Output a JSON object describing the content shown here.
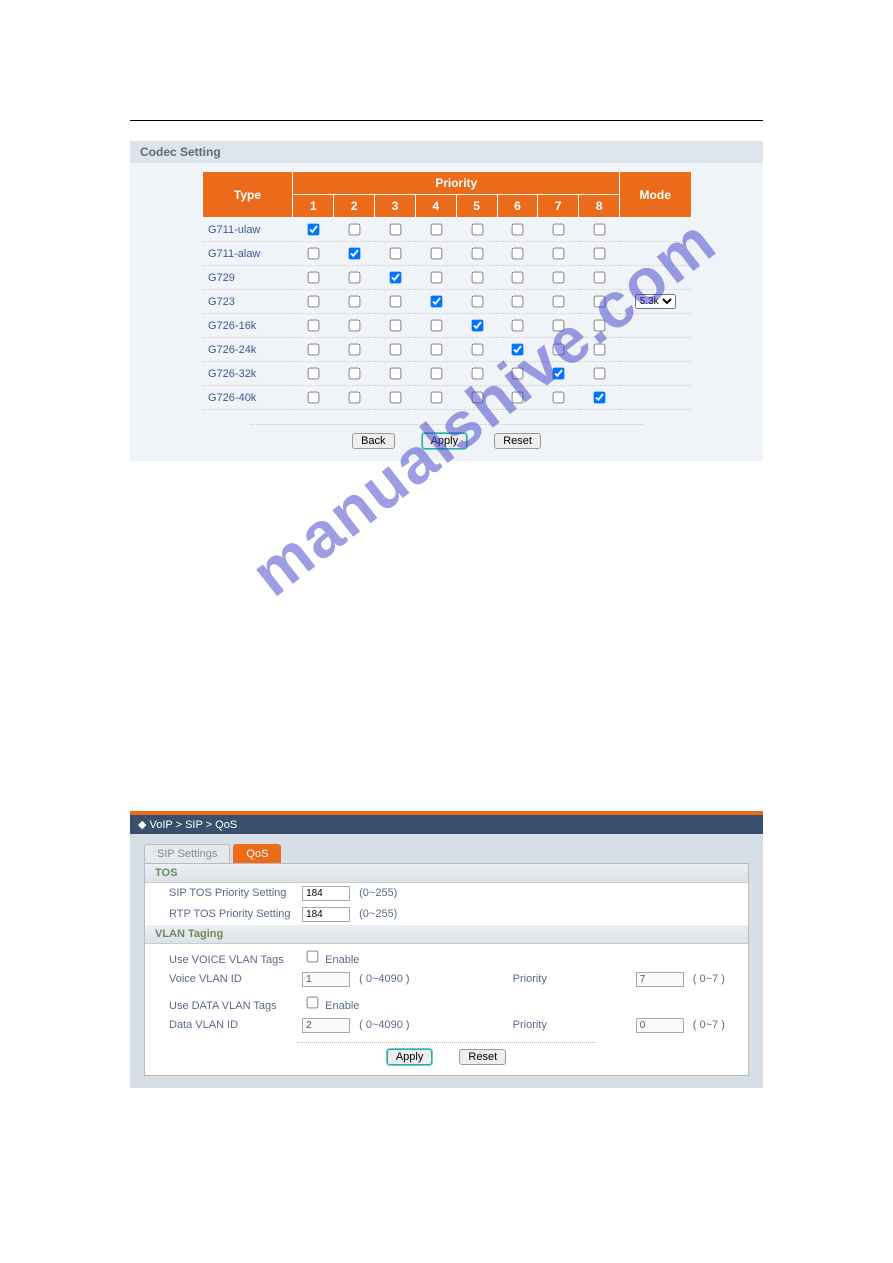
{
  "codec": {
    "panel_title": "Codec Setting",
    "header_type": "Type",
    "header_priority": "Priority",
    "header_mode": "Mode",
    "priorities": [
      "1",
      "2",
      "3",
      "4",
      "5",
      "6",
      "7",
      "8"
    ],
    "rows": [
      {
        "type": "G711-ulaw",
        "checked": [
          true,
          false,
          false,
          false,
          false,
          false,
          false,
          false
        ],
        "mode": null
      },
      {
        "type": "G711-alaw",
        "checked": [
          false,
          true,
          false,
          false,
          false,
          false,
          false,
          false
        ],
        "mode": null
      },
      {
        "type": "G729",
        "checked": [
          false,
          false,
          true,
          false,
          false,
          false,
          false,
          false
        ],
        "mode": null
      },
      {
        "type": "G723",
        "checked": [
          false,
          false,
          false,
          true,
          false,
          false,
          false,
          false
        ],
        "mode": "5.3k"
      },
      {
        "type": "G726-16k",
        "checked": [
          false,
          false,
          false,
          false,
          true,
          false,
          false,
          false
        ],
        "mode": null
      },
      {
        "type": "G726-24k",
        "checked": [
          false,
          false,
          false,
          false,
          false,
          true,
          false,
          false
        ],
        "mode": null
      },
      {
        "type": "G726-32k",
        "checked": [
          false,
          false,
          false,
          false,
          false,
          false,
          true,
          false
        ],
        "mode": null
      },
      {
        "type": "G726-40k",
        "checked": [
          false,
          false,
          false,
          false,
          false,
          false,
          false,
          true
        ],
        "mode": null
      }
    ],
    "buttons": {
      "back": "Back",
      "apply": "Apply",
      "reset": "Reset"
    }
  },
  "qos": {
    "breadcrumb": "◆  VoIP > SIP > QoS",
    "tabs": {
      "sip": "SIP Settings",
      "qos": "QoS"
    },
    "tos": {
      "header": "TOS",
      "sip_label": "SIP TOS Priority Setting",
      "sip_value": "184",
      "sip_range": "(0~255)",
      "rtp_label": "RTP TOS Priority Setting",
      "rtp_value": "184",
      "rtp_range": "(0~255)"
    },
    "vlan": {
      "header": "VLAN Taging",
      "use_voice_label": "Use VOICE VLAN Tags",
      "enable_label": "Enable",
      "voice_id_label": "Voice VLAN ID",
      "voice_id_value": "1",
      "id_range": "( 0~4090 )",
      "priority_label": "Priority",
      "voice_pri_value": "7",
      "pri_range": "( 0~7 )",
      "use_data_label": "Use DATA VLAN Tags",
      "data_id_label": "Data VLAN ID",
      "data_id_value": "2",
      "data_pri_value": "0"
    },
    "buttons": {
      "apply": "Apply",
      "reset": "Reset"
    }
  },
  "watermark": "manualshive.com"
}
